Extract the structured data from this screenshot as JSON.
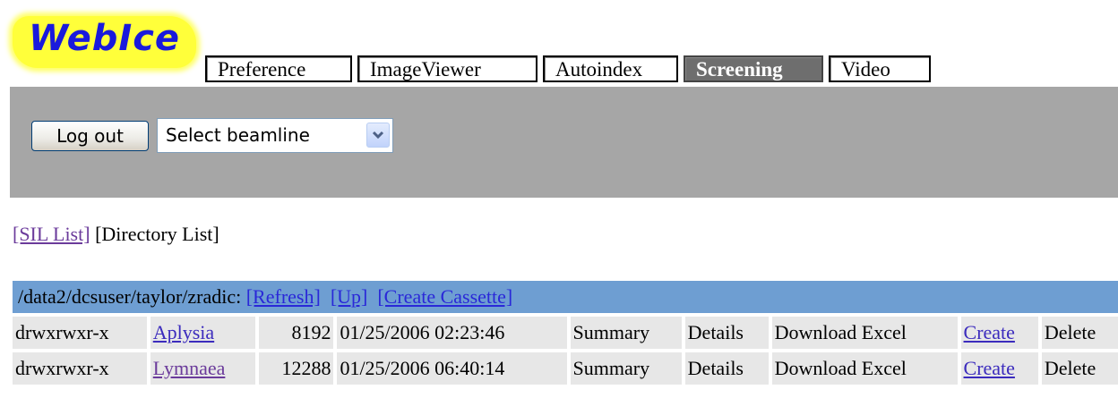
{
  "app": {
    "logo_text": "WebIce"
  },
  "tabs": [
    {
      "label": "Preference",
      "active": false
    },
    {
      "label": "ImageViewer",
      "active": false
    },
    {
      "label": "Autoindex",
      "active": false
    },
    {
      "label": "Screening",
      "active": true
    },
    {
      "label": "Video",
      "active": false
    }
  ],
  "toolbar": {
    "logout_label": "Log out",
    "beamline_select_value": "Select beamline"
  },
  "nav": {
    "sil_list": "[SIL List]",
    "directory_list": "[Directory List]"
  },
  "directory": {
    "path": "/data2/dcsuser/taylor/zradic:",
    "refresh": "[Refresh]",
    "up": "[Up]",
    "create_cassette": "[Create Cassette]",
    "rows": [
      {
        "permissions": "drwxrwxr-x",
        "name": "Aplysia",
        "size": "8192",
        "datetime": "01/25/2006 02:23:46",
        "summary": "Summary",
        "details": "Details",
        "download_excel": "Download Excel",
        "create": "Create",
        "delete": "Delete"
      },
      {
        "permissions": "drwxrwxr-x",
        "name": "Lymnaea",
        "size": "12288",
        "datetime": "01/25/2006 06:40:14",
        "summary": "Summary",
        "details": "Details",
        "download_excel": "Download Excel",
        "create": "Create",
        "delete": "Delete"
      }
    ]
  },
  "colors": {
    "toolbar_bg": "#a6a6a6",
    "header_bg": "#6e9ed2",
    "row_bg": "#e7e7e7",
    "logo_bg": "#ffff3a",
    "active_tab_bg": "#6e6e6e"
  }
}
